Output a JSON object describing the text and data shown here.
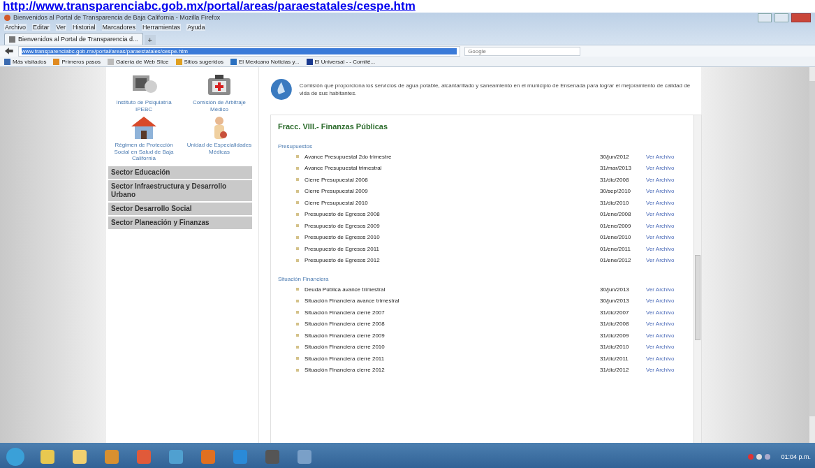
{
  "caption_link": "http://www.transparenciabc.gob.mx/portal/areas/paraestatales/cespe.htm",
  "window": {
    "title": "Bienvenidos al Portal de Transparencia de Baja California - Mozilla Firefox"
  },
  "menu": [
    "Archivo",
    "Editar",
    "Ver",
    "Historial",
    "Marcadores",
    "Herramientas",
    "Ayuda"
  ],
  "tabs": [
    {
      "label": "Bienvenidos al Portal de Transparencia d...",
      "selected": true
    }
  ],
  "new_tab": "+",
  "address": {
    "value": "www.transparenciabc.gob.mx/portal/areas/paraestatales/cespe.htm"
  },
  "search": {
    "placeholder": "Google"
  },
  "bookmarks": [
    "Más visitados",
    "Primeros pasos",
    "Galería de Web Slice",
    "Sitios sugeridos",
    "El Mexicano Noticias y...",
    "El Universal - - Comité..."
  ],
  "sidebar": {
    "agencies": [
      {
        "label": "Instituto de Psiquiatría IPEBC"
      },
      {
        "label": "Comisión de Arbitraje Médico"
      },
      {
        "label": "Régimen de Protección Social en Salud de Baja California"
      },
      {
        "label": "Unidad de Especialidades Médicas"
      }
    ],
    "sectors": [
      "Sector Educación",
      "Sector Infraestructura y Desarrollo Urbano",
      "Sector Desarrollo Social",
      "Sector Planeación y Finanzas"
    ]
  },
  "description": "Comisión que proporciona los servicios de agua potable, alcantarillado y saneamiento en el municipio de Ensenada para lograr el mejoramiento de calidad de vida de sus habitantes.",
  "heading": "Fracc. VIII.- Finanzas Públicas",
  "sections": [
    {
      "title": "Presupuestos",
      "rows": [
        {
          "name": "Avance Presupuestal 2do trimestre",
          "date": "30/jun/2012",
          "link": "Ver Archivo"
        },
        {
          "name": "Avance Presupuestal trimestral",
          "date": "31/mar/2013",
          "link": "Ver Archivo"
        },
        {
          "name": "Cierre Presupuestal 2008",
          "date": "31/dic/2008",
          "link": "Ver Archivo"
        },
        {
          "name": "Cierre Presupuestal 2009",
          "date": "30/sep/2010",
          "link": "Ver Archivo"
        },
        {
          "name": "Cierre Presupuestal 2010",
          "date": "31/dic/2010",
          "link": "Ver Archivo"
        },
        {
          "name": "Presupuesto de Egresos 2008",
          "date": "01/ene/2008",
          "link": "Ver Archivo"
        },
        {
          "name": "Presupuesto de Egresos 2009",
          "date": "01/ene/2009",
          "link": "Ver Archivo"
        },
        {
          "name": "Presupuesto de Egresos 2010",
          "date": "01/ene/2010",
          "link": "Ver Archivo"
        },
        {
          "name": "Presupuesto de Egresos 2011",
          "date": "01/ene/2011",
          "link": "Ver Archivo"
        },
        {
          "name": "Presupuesto de Egresos 2012",
          "date": "01/ene/2012",
          "link": "Ver Archivo"
        }
      ]
    },
    {
      "title": "Situación Financiera",
      "rows": [
        {
          "name": "Deuda Pública avance trimestral",
          "date": "30/jun/2013",
          "link": "Ver Archivo"
        },
        {
          "name": "Situación Financiera avance trimestral",
          "date": "30/jun/2013",
          "link": "Ver Archivo"
        },
        {
          "name": "Situación Financiera cierre 2007",
          "date": "31/dic/2007",
          "link": "Ver Archivo"
        },
        {
          "name": "Situación Financiera cierre 2008",
          "date": "31/dic/2008",
          "link": "Ver Archivo"
        },
        {
          "name": "Situación Financiera cierre 2009",
          "date": "31/dic/2009",
          "link": "Ver Archivo"
        },
        {
          "name": "Situación Financiera cierre 2010",
          "date": "31/dic/2010",
          "link": "Ver Archivo"
        },
        {
          "name": "Situación Financiera cierre 2011",
          "date": "31/dic/2011",
          "link": "Ver Archivo"
        },
        {
          "name": "Situación Financiera cierre 2012",
          "date": "31/dic/2012",
          "link": "Ver Archivo"
        }
      ]
    }
  ],
  "clock": "01:04 p.m."
}
